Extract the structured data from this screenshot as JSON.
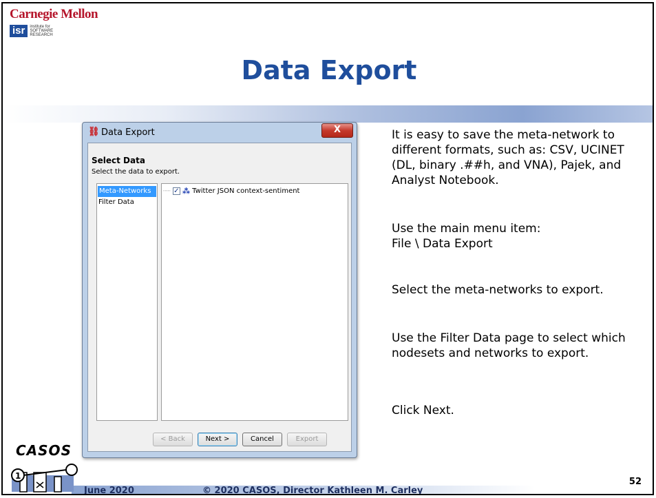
{
  "header": {
    "cmu_logo": "Carnegie Mellon",
    "isr_logo_box": "isr",
    "isr_logo_text": "institute for SOFTWARE RESEARCH",
    "title": "Data Export"
  },
  "dialog": {
    "title": "Data Export",
    "close": "X",
    "section_title": "Select Data",
    "section_subtitle": "Select the data to export.",
    "left_items": [
      "Meta-Networks",
      "Filter Data"
    ],
    "tree_item": "Twitter JSON context-sentiment",
    "tree_checked": true,
    "buttons": {
      "back": "< Back",
      "next": "Next >",
      "cancel": "Cancel",
      "export": "Export"
    }
  },
  "body": {
    "p1": "It is easy to save the meta-network to different formats, such as: CSV, UCINET (DL, binary .##h, and VNA), Pajek, and Analyst Notebook.",
    "p2_a": "Use the main menu item:",
    "p2_b": "File \\ Data Export",
    "p3": "Select the meta-networks to export.",
    "p4": "Use the Filter Data page to select which nodesets and networks to export.",
    "p5": "Click Next."
  },
  "footer": {
    "casos_logo": "CASOS",
    "date": "June 2020",
    "copyright": "© 2020 CASOS, Director Kathleen M. Carley",
    "page_number": "52"
  },
  "colors": {
    "title": "#1f4e9c",
    "cmu_red": "#b5152b",
    "selection": "#3399ff"
  }
}
